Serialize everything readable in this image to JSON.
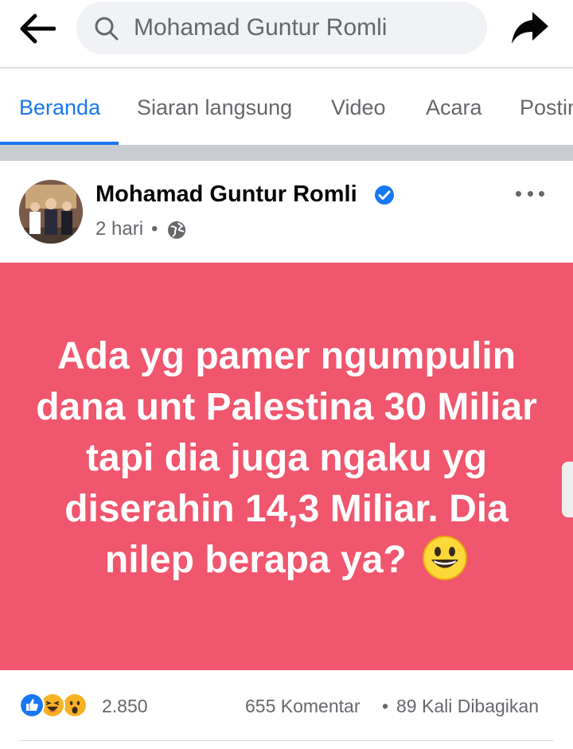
{
  "search": {
    "query": "Mohamad Guntur Romli"
  },
  "tabs": [
    {
      "label": "Beranda",
      "active": true
    },
    {
      "label": "Siaran langsung",
      "active": false
    },
    {
      "label": "Video",
      "active": false
    },
    {
      "label": "Acara",
      "active": false
    },
    {
      "label": "Postin",
      "active": false
    }
  ],
  "post": {
    "author": "Mohamad Guntur Romli",
    "verified": true,
    "time": "2 hari",
    "separator": "•",
    "privacy_icon": "globe-icon",
    "text": "Ada yg pamer ngumpulin dana unt Palestina 30 Miliar tapi dia juga ngaku yg diserahin 14,3 Miliar. Dia nilep berapa ya?",
    "card_color": "#f0566d",
    "emoji": "grinning-face-emoji"
  },
  "reactions": {
    "icons": [
      "like-icon",
      "haha-icon",
      "wow-icon"
    ],
    "count": "2.850",
    "comments": "655 Komentar",
    "separator": "•",
    "shares": "89 Kali Dibagikan"
  },
  "colors": {
    "accent": "#1877f2",
    "secondary_text": "#65676b"
  }
}
